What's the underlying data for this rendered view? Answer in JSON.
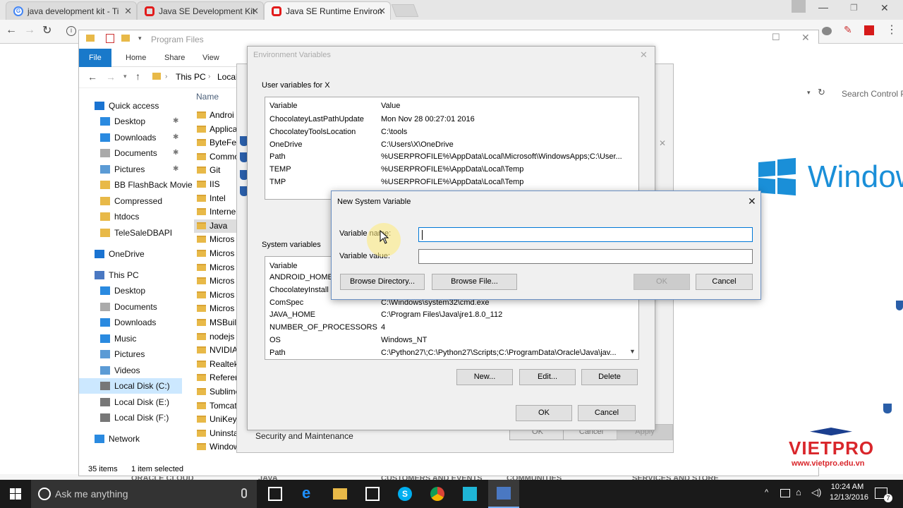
{
  "browser": {
    "tabs": [
      {
        "label": "java development kit - Ti",
        "icon": "google-g-icon",
        "color": "#4285f4"
      },
      {
        "label": "Java SE Development Kit",
        "icon": "oracle-icon",
        "color": "#e21b1b"
      },
      {
        "label": "Java SE Runtime Environ",
        "icon": "oracle-icon",
        "color": "#e21b1b"
      }
    ],
    "site_menu": [
      "ORACLE CLOUD",
      "JAVA",
      "CUSTOMERS AND EVENTS",
      "COMMUNITIES",
      "SERVICES AND STORE"
    ]
  },
  "explorer": {
    "title": "Program Files",
    "ribbon_tabs": [
      "File",
      "Home",
      "Share",
      "View"
    ],
    "breadcrumb": [
      "This PC",
      "Local"
    ],
    "column_name": "Name",
    "nav": [
      {
        "label": "Quick access",
        "icon": "star-icon",
        "top": true
      },
      {
        "label": "Desktop",
        "icon": "desktop-icon",
        "pinned": true
      },
      {
        "label": "Downloads",
        "icon": "download-icon",
        "pinned": true
      },
      {
        "label": "Documents",
        "icon": "documents-icon",
        "pinned": true
      },
      {
        "label": "Pictures",
        "icon": "pictures-icon",
        "pinned": true
      },
      {
        "label": "BB FlashBack Movie",
        "icon": "folder-icon"
      },
      {
        "label": "Compressed",
        "icon": "folder-icon"
      },
      {
        "label": "htdocs",
        "icon": "folder-icon"
      },
      {
        "label": "TeleSaleDBAPI",
        "icon": "folder-icon"
      },
      {
        "label": "OneDrive",
        "icon": "cloud-icon",
        "top": true
      },
      {
        "label": "This PC",
        "icon": "computer-icon",
        "top": true
      },
      {
        "label": "Desktop",
        "icon": "desktop-icon"
      },
      {
        "label": "Documents",
        "icon": "documents-icon"
      },
      {
        "label": "Downloads",
        "icon": "download-icon"
      },
      {
        "label": "Music",
        "icon": "music-icon"
      },
      {
        "label": "Pictures",
        "icon": "pictures-icon"
      },
      {
        "label": "Videos",
        "icon": "videos-icon"
      },
      {
        "label": "Local Disk (C:)",
        "icon": "drive-icon",
        "selected": true
      },
      {
        "label": "Local Disk (E:)",
        "icon": "drive-icon"
      },
      {
        "label": "Local Disk (F:)",
        "icon": "drive-icon"
      },
      {
        "label": "Network",
        "icon": "network-icon",
        "top": true
      }
    ],
    "files": [
      "Androi",
      "Applica",
      "ByteFer",
      "Commo",
      "Git",
      "IIS",
      "Intel",
      "Interne",
      "Java",
      "Micros",
      "Micros",
      "Micros",
      "Micros",
      "Micros",
      "Micros",
      "MSBuil",
      "nodejs",
      "NVIDIA",
      "Realtek",
      "Referer",
      "Sublime",
      "Tomcat",
      "UniKey",
      "Uninsta",
      "Window"
    ],
    "status_items": "35 items",
    "status_selected": "1 item selected"
  },
  "control_panel": {
    "search_placeholder": "Search Control Pa",
    "windows_logo_text": "Window",
    "security_link": "Security and Maintenance",
    "ok_label": "OK",
    "cancel_label": "Cancel",
    "apply_label": "Apply"
  },
  "env_dialog": {
    "title": "Environment Variables",
    "user_section": "User variables for X",
    "col_variable": "Variable",
    "col_value": "Value",
    "user_vars": [
      {
        "name": "ChocolateyLastPathUpdate",
        "value": "Mon Nov 28 00:27:01 2016"
      },
      {
        "name": "ChocolateyToolsLocation",
        "value": "C:\\tools"
      },
      {
        "name": "OneDrive",
        "value": "C:\\Users\\X\\OneDrive"
      },
      {
        "name": "Path",
        "value": "%USERPROFILE%\\AppData\\Local\\Microsoft\\WindowsApps;C:\\User..."
      },
      {
        "name": "TEMP",
        "value": "%USERPROFILE%\\AppData\\Local\\Temp"
      },
      {
        "name": "TMP",
        "value": "%USERPROFILE%\\AppData\\Local\\Temp"
      }
    ],
    "system_section": "System variables",
    "system_vars": [
      {
        "name": "ANDROID_HOME",
        "value": ""
      },
      {
        "name": "ChocolateyInstall",
        "value": ""
      },
      {
        "name": "ComSpec",
        "value": "C:\\Windows\\system32\\cmd.exe"
      },
      {
        "name": "JAVA_HOME",
        "value": "C:\\Program Files\\Java\\jre1.8.0_112"
      },
      {
        "name": "NUMBER_OF_PROCESSORS",
        "value": "4"
      },
      {
        "name": "OS",
        "value": "Windows_NT"
      },
      {
        "name": "Path",
        "value": "C:\\Python27\\;C:\\Python27\\Scripts;C:\\ProgramData\\Oracle\\Java\\jav..."
      }
    ],
    "new_label": "New...",
    "edit_label": "Edit...",
    "delete_label": "Delete",
    "ok_label": "OK",
    "cancel_label": "Cancel"
  },
  "new_var_dialog": {
    "title": "New System Variable",
    "name_label": "Variable name:",
    "value_label": "Variable value:",
    "name_value": "",
    "value_value": "",
    "browse_dir_label": "Browse Directory...",
    "browse_file_label": "Browse File...",
    "ok_label": "OK",
    "cancel_label": "Cancel"
  },
  "watermark": {
    "brand": "VIETPRO",
    "url": "www.vietpro.edu.vn"
  },
  "taskbar": {
    "search_placeholder": "Ask me anything",
    "time": "10:24 AM",
    "date": "12/13/2016",
    "notification_count": "7"
  },
  "colors": {
    "accent": "#0078d7",
    "ribbon_file": "#1979ca",
    "windows_blue": "#1a8fd8",
    "vietpro_red": "#d9262b",
    "vietpro_blue": "#1b3f8f"
  }
}
